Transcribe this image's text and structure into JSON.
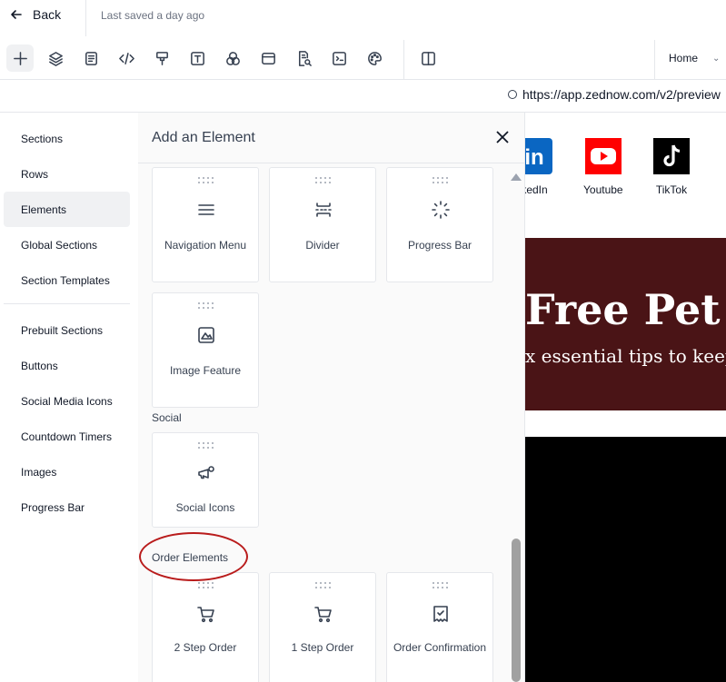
{
  "header": {
    "back_label": "Back",
    "saved_status": "Last saved a day ago"
  },
  "toolbar": {
    "icons": [
      "plus-icon",
      "layers-icon",
      "page-icon",
      "code-icon",
      "paint-roller-icon",
      "text-icon",
      "shapes-icon",
      "browser-window-icon",
      "page-search-icon",
      "terminal-icon",
      "palette-icon",
      "split-view-icon"
    ],
    "page_select": "Home"
  },
  "url_bar": {
    "url": "https://app.zednow.com/v2/preview"
  },
  "categories": {
    "items": [
      {
        "label": "Sections"
      },
      {
        "label": "Rows"
      },
      {
        "label": "Elements"
      },
      {
        "label": "Global Sections"
      },
      {
        "label": "Section Templates"
      },
      {
        "label": "Prebuilt Sections"
      },
      {
        "label": "Buttons"
      },
      {
        "label": "Social Media Icons"
      },
      {
        "label": "Countdown Timers"
      },
      {
        "label": "Images"
      },
      {
        "label": "Progress Bar"
      }
    ],
    "active": "Elements"
  },
  "panel": {
    "title": "Add an Element",
    "elements": [
      {
        "label": "Navigation Menu",
        "icon": "menu-icon"
      },
      {
        "label": "Divider",
        "icon": "divider-icon"
      },
      {
        "label": "Progress Bar",
        "icon": "loader-icon"
      },
      {
        "label": "Image Feature",
        "icon": "image-icon"
      }
    ],
    "social_label": "Social",
    "social": [
      {
        "label": "Social Icons",
        "icon": "megaphone-icon"
      }
    ],
    "order_label": "Order Elements",
    "order": [
      {
        "label": "2 Step Order",
        "icon": "cart-icon"
      },
      {
        "label": "1 Step Order",
        "icon": "cart-icon"
      },
      {
        "label": "Order Confirmation",
        "icon": "receipt-check-icon"
      }
    ]
  },
  "preview": {
    "social_links": [
      {
        "name": "kedIn",
        "icon": "linkedin-icon"
      },
      {
        "name": "Youtube",
        "icon": "youtube-icon"
      },
      {
        "name": "TikTok",
        "icon": "tiktok-icon"
      }
    ],
    "hero_title": "Free Pet",
    "hero_subtitle": "x essential tips to keep",
    "hero_color": "#4a1416"
  }
}
